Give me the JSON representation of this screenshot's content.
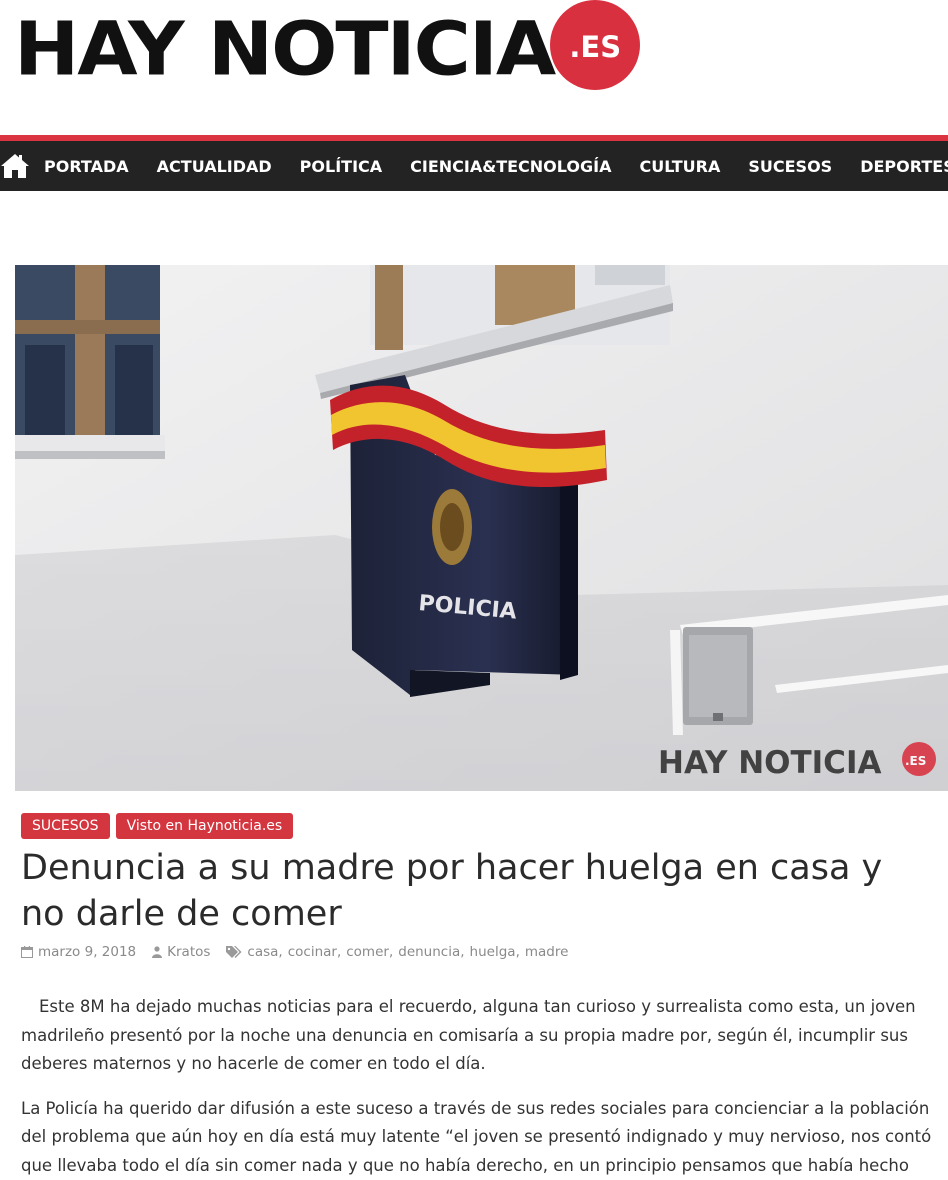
{
  "logo": {
    "text": "HAY NOTICIA",
    "badge": ".ES",
    "badge_color": "#d9303f"
  },
  "nav": {
    "home_icon": "home-icon",
    "items": [
      "PORTADA",
      "ACTUALIDAD",
      "POLÍTICA",
      "CIENCIA&TECNOLOGÍA",
      "CULTURA",
      "SUCESOS",
      "DEPORTES"
    ],
    "background": "#232323",
    "accent": "#d9343f"
  },
  "hero": {
    "sign_text": "POLICIA",
    "watermark_text": "HAY NOTICIA",
    "watermark_badge": ".ES"
  },
  "article": {
    "categories": [
      "SUCESOS",
      "Visto en Haynoticia.es"
    ],
    "title": "Denuncia a su madre por hacer huelga en casa y no darle de comer",
    "date": "marzo 9, 2018",
    "author": "Kratos",
    "tags": [
      "casa",
      "cocinar",
      "comer",
      "denuncia",
      "huelga",
      "madre"
    ],
    "paragraphs": [
      "Este 8M ha dejado muchas noticias para el recuerdo, alguna tan curioso y surrealista como esta, un joven madrileño presentó por la noche una denuncia en comisaría a su propia madre por, según él, incumplir sus deberes maternos y no hacerle de comer en todo el día.",
      "La Policía ha querido dar difusión a este suceso a través de sus redes sociales para concienciar a la población del problema que aún hoy en día está muy latente “el joven se presentó indignado y muy nervioso, nos contó que llevaba todo el día sin comer nada y que no había derecho, en un principio pensamos que había hecho"
    ]
  }
}
